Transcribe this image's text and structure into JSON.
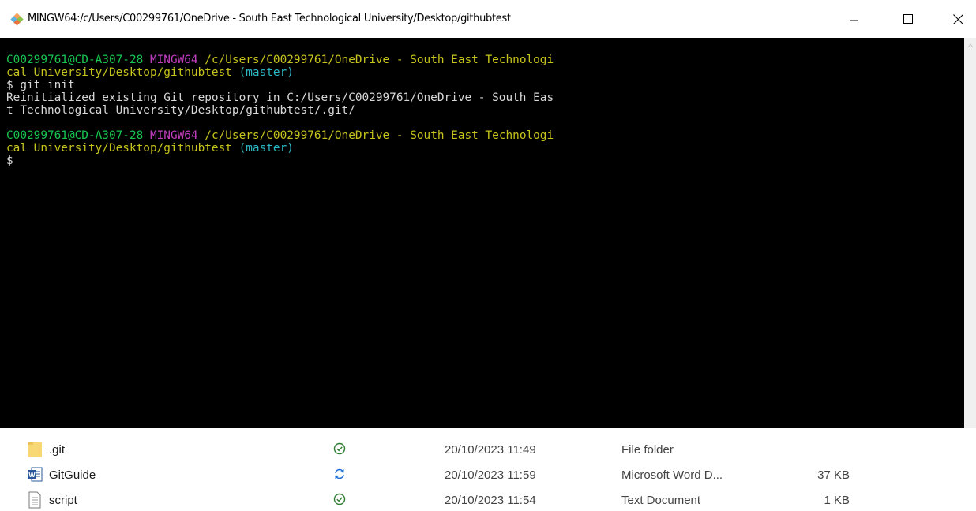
{
  "window": {
    "title": "MINGW64:/c/Users/C00299761/OneDrive - South East Technological University/Desktop/githubtest",
    "icon": "git-icon",
    "controls": [
      "minimize-icon",
      "maximize-icon",
      "close-icon"
    ]
  },
  "terminal": {
    "prompt1": {
      "user_host": "C00299761@CD-A307-28",
      "shell": "MINGW64",
      "path_part1": "/c/Users/C00299761/OneDrive - South East Technologi",
      "path_part2": "cal University/Desktop/githubtest",
      "branch": "(master)"
    },
    "command1": "$ git init",
    "output_line1": "Reinitialized existing Git repository in C:/Users/C00299761/OneDrive - South Eas",
    "output_line2": "t Technological University/Desktop/githubtest/.git/",
    "prompt2": {
      "user_host": "C00299761@CD-A307-28",
      "shell": "MINGW64",
      "path_part1": "/c/Users/C00299761/OneDrive - South East Technologi",
      "path_part2": "cal University/Desktop/githubtest",
      "branch": "(master)"
    },
    "cursor_line": "$"
  },
  "files": [
    {
      "name": ".git",
      "icon": "folder-icon",
      "status": "synced-icon",
      "date": "20/10/2023 11:49",
      "type": "File folder",
      "size": ""
    },
    {
      "name": "GitGuide",
      "icon": "word-doc-icon",
      "status": "syncing-icon",
      "date": "20/10/2023 11:59",
      "type": "Microsoft Word D...",
      "size": "37 KB"
    },
    {
      "name": "script",
      "icon": "text-doc-icon",
      "status": "synced-icon",
      "date": "20/10/2023 11:54",
      "type": "Text Document",
      "size": "1 KB"
    }
  ],
  "colors": {
    "prompt_user": "#19c54f",
    "prompt_shell": "#c33ec0",
    "prompt_path": "#c6c41c",
    "prompt_branch": "#2bb6c2",
    "sync_ok": "#2e7d32",
    "sync_pending": "#1e6bd6"
  }
}
